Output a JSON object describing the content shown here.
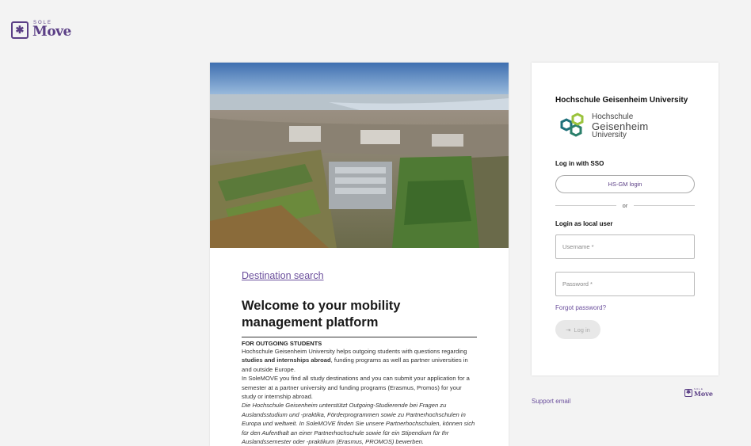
{
  "brand": {
    "sole": "SOLE",
    "move": "Move",
    "icon": "asterisk-box-icon"
  },
  "left": {
    "destination_link": "Destination search",
    "welcome_title": "Welcome to your mobility management platform",
    "section_title": "FOR OUTGOING STUDENTS",
    "para1_a": "Hochschule Geisenheim University helps outgoing students with questions regarding ",
    "para1_b": "studies and internships abroad",
    "para1_c": ", funding programs as well as partner universities in and outside Europe.",
    "para2": "In SoleMOVE you find all study destinations and you can submit your application for a semester at a partner university and funding programs (Erasmus, Promos) for your study or internship abroad.",
    "para3": "Die Hochschule Geisenheim unterstützt Outgoing-Studierende bei Fragen zu Auslandsstudium und -praktika, Förderprogrammen sowie zu Partnerhochschulen in Europa und weltweit. In SoleMOVE finden Sie unsere Partnerhochschulen, können sich für den Aufenthalt an einer Partnerhochschule sowie für ein Stipendium für Ihr Auslandssemester oder -praktikum (Erasmus, PROMOS) bewerben."
  },
  "login": {
    "university_name": "Hochschule Geisenheim University",
    "logo_line1": "Hochschule",
    "logo_line2": "Geisenheim",
    "logo_line3": "University",
    "sso_title": "Log in with SSO",
    "sso_button": "HS-GM login",
    "or": "or",
    "local_title": "Login as local user",
    "username_placeholder": "Username *",
    "password_placeholder": "Password *",
    "forgot": "Forgot password?",
    "login_button": "Log in"
  },
  "footer": {
    "support": "Support email",
    "sole": "SOLE",
    "move": "Move"
  },
  "colors": {
    "accent": "#5b3f86",
    "link": "#6b4f9c",
    "background": "#f3f3f3"
  }
}
